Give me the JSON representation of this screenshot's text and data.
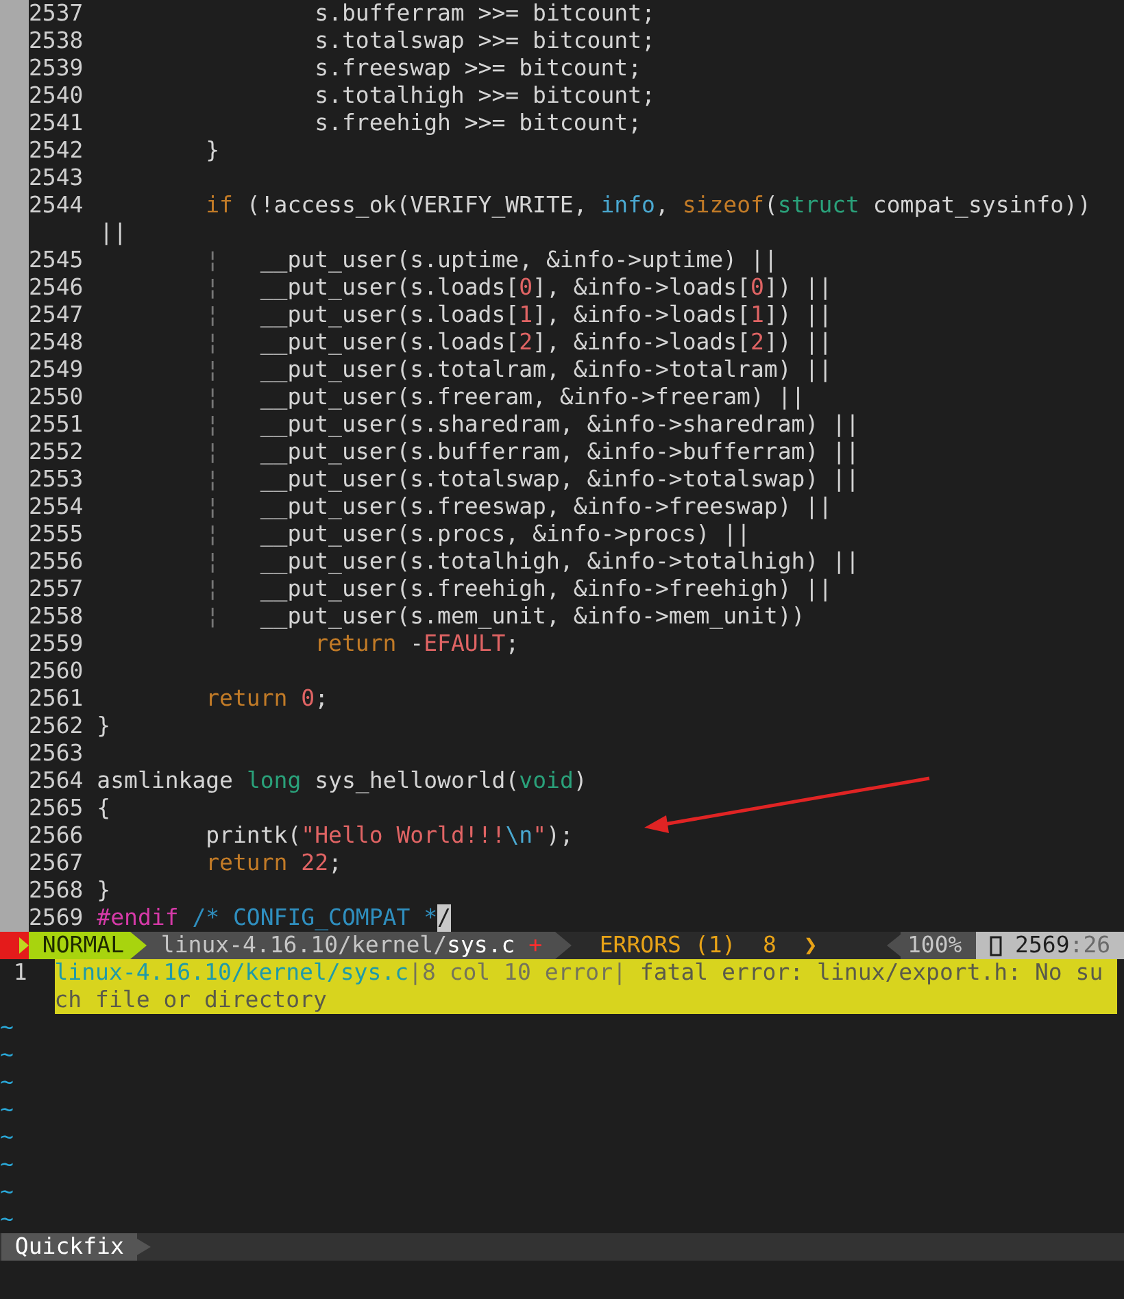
{
  "editor": {
    "lines": [
      {
        "number": "2537",
        "segments": [
          {
            "kind": "plain",
            "text": "                s.bufferram >>= bitcount;"
          }
        ]
      },
      {
        "number": "2538",
        "segments": [
          {
            "kind": "plain",
            "text": "                s.totalswap >>= bitcount;"
          }
        ]
      },
      {
        "number": "2539",
        "segments": [
          {
            "kind": "plain",
            "text": "                s.freeswap >>= bitcount;"
          }
        ]
      },
      {
        "number": "2540",
        "segments": [
          {
            "kind": "plain",
            "text": "                s.totalhigh >>= bitcount;"
          }
        ]
      },
      {
        "number": "2541",
        "segments": [
          {
            "kind": "plain",
            "text": "                s.freehigh >>= bitcount;"
          }
        ]
      },
      {
        "number": "2542",
        "segments": [
          {
            "kind": "plain",
            "text": "        }"
          }
        ]
      },
      {
        "number": "2543"
      },
      {
        "number": "2544",
        "segments": [
          {
            "kind": "keyword",
            "text": "        if"
          },
          {
            "kind": "plain",
            "text": " (!access_ok(VERIFY_WRITE, "
          },
          {
            "kind": "identifier",
            "text": "info"
          },
          {
            "kind": "plain",
            "text": ", "
          },
          {
            "kind": "keyword",
            "text": "sizeof"
          },
          {
            "kind": "plain",
            "text": "("
          },
          {
            "kind": "type",
            "text": "struct"
          },
          {
            "kind": "plain",
            "text": " compat_sysinfo))"
          }
        ],
        "wrap": [
          {
            "kind": "plain",
            "text": "||"
          }
        ]
      },
      {
        "number": "2545",
        "segments": [
          {
            "kind": "guide",
            "text": "        ¦"
          },
          {
            "kind": "plain",
            "text": "   __put_user(s.uptime, &info->uptime) ||"
          }
        ]
      },
      {
        "number": "2546",
        "segments": [
          {
            "kind": "guide",
            "text": "        ¦"
          },
          {
            "kind": "plain",
            "text": "   __put_user(s.loads["
          },
          {
            "kind": "number",
            "text": "0"
          },
          {
            "kind": "plain",
            "text": "], &info->loads["
          },
          {
            "kind": "number",
            "text": "0"
          },
          {
            "kind": "plain",
            "text": "]) ||"
          }
        ]
      },
      {
        "number": "2547",
        "segments": [
          {
            "kind": "guide",
            "text": "        ¦"
          },
          {
            "kind": "plain",
            "text": "   __put_user(s.loads["
          },
          {
            "kind": "number",
            "text": "1"
          },
          {
            "kind": "plain",
            "text": "], &info->loads["
          },
          {
            "kind": "number",
            "text": "1"
          },
          {
            "kind": "plain",
            "text": "]) ||"
          }
        ]
      },
      {
        "number": "2548",
        "segments": [
          {
            "kind": "guide",
            "text": "        ¦"
          },
          {
            "kind": "plain",
            "text": "   __put_user(s.loads["
          },
          {
            "kind": "number",
            "text": "2"
          },
          {
            "kind": "plain",
            "text": "], &info->loads["
          },
          {
            "kind": "number",
            "text": "2"
          },
          {
            "kind": "plain",
            "text": "]) ||"
          }
        ]
      },
      {
        "number": "2549",
        "segments": [
          {
            "kind": "guide",
            "text": "        ¦"
          },
          {
            "kind": "plain",
            "text": "   __put_user(s.totalram, &info->totalram) ||"
          }
        ]
      },
      {
        "number": "2550",
        "segments": [
          {
            "kind": "guide",
            "text": "        ¦"
          },
          {
            "kind": "plain",
            "text": "   __put_user(s.freeram, &info->freeram) ||"
          }
        ]
      },
      {
        "number": "2551",
        "segments": [
          {
            "kind": "guide",
            "text": "        ¦"
          },
          {
            "kind": "plain",
            "text": "   __put_user(s.sharedram, &info->sharedram) ||"
          }
        ]
      },
      {
        "number": "2552",
        "segments": [
          {
            "kind": "guide",
            "text": "        ¦"
          },
          {
            "kind": "plain",
            "text": "   __put_user(s.bufferram, &info->bufferram) ||"
          }
        ]
      },
      {
        "number": "2553",
        "segments": [
          {
            "kind": "guide",
            "text": "        ¦"
          },
          {
            "kind": "plain",
            "text": "   __put_user(s.totalswap, &info->totalswap) ||"
          }
        ]
      },
      {
        "number": "2554",
        "segments": [
          {
            "kind": "guide",
            "text": "        ¦"
          },
          {
            "kind": "plain",
            "text": "   __put_user(s.freeswap, &info->freeswap) ||"
          }
        ]
      },
      {
        "number": "2555",
        "segments": [
          {
            "kind": "guide",
            "text": "        ¦"
          },
          {
            "kind": "plain",
            "text": "   __put_user(s.procs, &info->procs) ||"
          }
        ]
      },
      {
        "number": "2556",
        "segments": [
          {
            "kind": "guide",
            "text": "        ¦"
          },
          {
            "kind": "plain",
            "text": "   __put_user(s.totalhigh, &info->totalhigh) ||"
          }
        ]
      },
      {
        "number": "2557",
        "segments": [
          {
            "kind": "guide",
            "text": "        ¦"
          },
          {
            "kind": "plain",
            "text": "   __put_user(s.freehigh, &info->freehigh) ||"
          }
        ]
      },
      {
        "number": "2558",
        "segments": [
          {
            "kind": "guide",
            "text": "        ¦"
          },
          {
            "kind": "plain",
            "text": "   __put_user(s.mem_unit, &info->mem_unit))"
          }
        ]
      },
      {
        "number": "2559",
        "segments": [
          {
            "kind": "keyword",
            "text": "                return"
          },
          {
            "kind": "plain",
            "text": " -"
          },
          {
            "kind": "number",
            "text": "EFAULT"
          },
          {
            "kind": "plain",
            "text": ";"
          }
        ]
      },
      {
        "number": "2560"
      },
      {
        "number": "2561",
        "segments": [
          {
            "kind": "keyword",
            "text": "        return"
          },
          {
            "kind": "number",
            "text": " 0"
          },
          {
            "kind": "plain",
            "text": ";"
          }
        ]
      },
      {
        "number": "2562",
        "segments": [
          {
            "kind": "plain",
            "text": "}"
          }
        ]
      },
      {
        "number": "2563"
      },
      {
        "number": "2564",
        "segments": [
          {
            "kind": "plain",
            "text": "asmlinkage "
          },
          {
            "kind": "type",
            "text": "long"
          },
          {
            "kind": "plain",
            "text": " sys_helloworld("
          },
          {
            "kind": "type",
            "text": "void"
          },
          {
            "kind": "plain",
            "text": ")"
          }
        ]
      },
      {
        "number": "2565",
        "segments": [
          {
            "kind": "plain",
            "text": "{"
          }
        ]
      },
      {
        "number": "2566",
        "segments": [
          {
            "kind": "plain",
            "text": "        printk("
          },
          {
            "kind": "string",
            "text": "\"Hello World!!!"
          },
          {
            "kind": "identifier",
            "text": "\\n"
          },
          {
            "kind": "string",
            "text": "\""
          },
          {
            "kind": "plain",
            "text": ");"
          }
        ]
      },
      {
        "number": "2567",
        "segments": [
          {
            "kind": "keyword",
            "text": "        return"
          },
          {
            "kind": "number",
            "text": " 22"
          },
          {
            "kind": "plain",
            "text": ";"
          }
        ]
      },
      {
        "number": "2568",
        "segments": [
          {
            "kind": "plain",
            "text": "}"
          }
        ]
      },
      {
        "number": "2569",
        "segments": [
          {
            "kind": "preproc",
            "text": "#endif"
          },
          {
            "kind": "comment",
            "text": " /* CONFIG_COMPAT *"
          },
          {
            "kind": "cursor",
            "text": "/"
          }
        ]
      }
    ]
  },
  "status_line": {
    "mode": "NORMAL",
    "path": "linux-4.16.10/kernel/",
    "file": "sys.c",
    "modified": true,
    "modified_mark": "+",
    "errors": "ERRORS (1)",
    "error_line": "8",
    "error_arrow": "❯",
    "percent": "100%",
    "line": "2569",
    "column": ":26"
  },
  "quickfix": {
    "entries": [
      {
        "number": "1",
        "file": "linux-4.16.10/kernel/sys.c",
        "location": "|8 col 10 error|",
        "message": " fatal error: linux/export.h: No such file or directory",
        "selected": true
      }
    ],
    "empty_lines": [
      "~",
      "~",
      "~",
      "~",
      "~",
      "~",
      "~",
      "~"
    ],
    "status": {
      "title": "Quickfix"
    }
  }
}
